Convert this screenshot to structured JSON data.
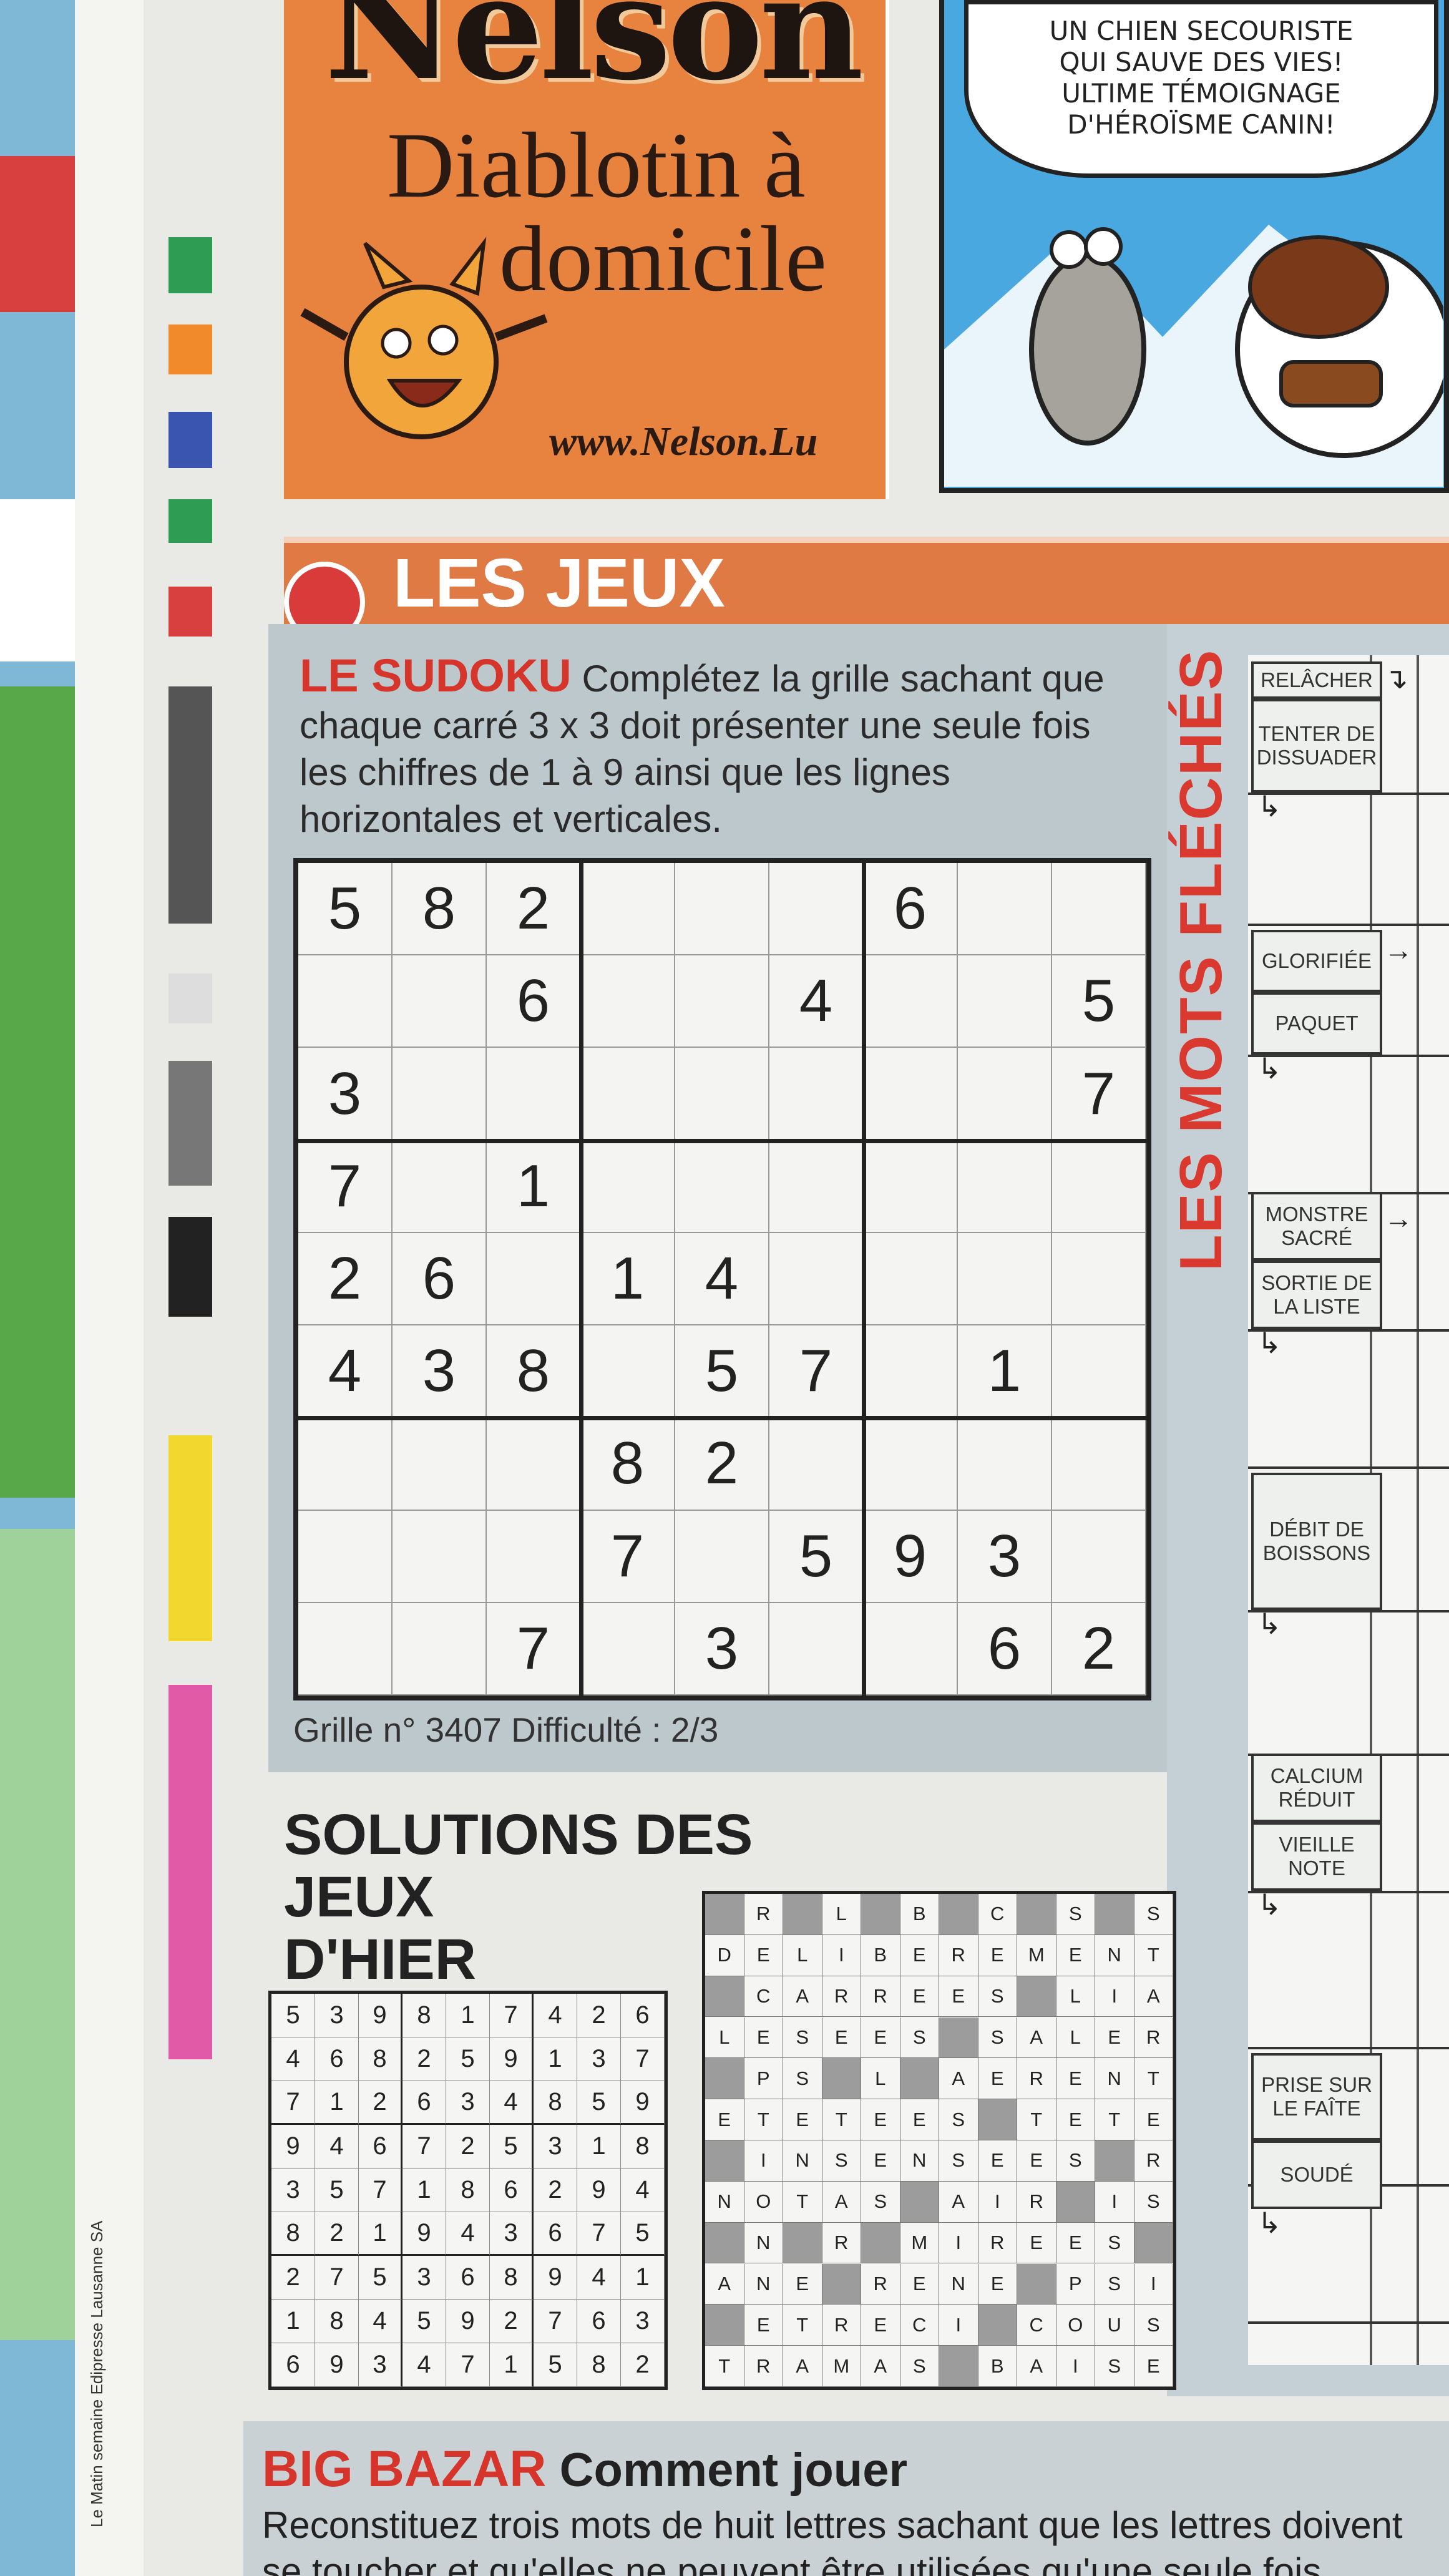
{
  "comic_left": {
    "title": "Nelson",
    "subtitle_line1": "Diablotin à",
    "subtitle_line2": "domicile",
    "url": "www.Nelson.Lu"
  },
  "comic_right": {
    "bubble_lines": [
      "UN CHIEN SECOURISTE",
      "QUI SAUVE DES VIES!",
      "ULTIME TÉMOIGNAGE",
      "D'HÉROÏSME CANIN!"
    ]
  },
  "section_title": "LES JEUX",
  "sudoku": {
    "title": "LE SUDOKU",
    "instructions": "Complétez la grille sachant que chaque carré 3 x 3 doit présenter une seule fois les chiffres de 1 à 9 ainsi que les lignes horizontales et verticales.",
    "grid": [
      [
        "5",
        "8",
        "2",
        "",
        "",
        "",
        "6",
        "",
        ""
      ],
      [
        "",
        "",
        "6",
        "",
        "",
        "4",
        "",
        "",
        "5"
      ],
      [
        "3",
        "",
        "",
        "",
        "",
        "",
        "",
        "",
        "7"
      ],
      [
        "7",
        "",
        "1",
        "",
        "",
        "",
        "",
        "",
        ""
      ],
      [
        "2",
        "6",
        "",
        "1",
        "4",
        "",
        "",
        "",
        ""
      ],
      [
        "4",
        "3",
        "8",
        "",
        "5",
        "7",
        "",
        "1",
        ""
      ],
      [
        "",
        "",
        "",
        "8",
        "2",
        "",
        "",
        "",
        ""
      ],
      [
        "",
        "",
        "",
        "7",
        "",
        "5",
        "9",
        "3",
        ""
      ],
      [
        "",
        "",
        "7",
        "",
        "3",
        "",
        "",
        "6",
        "2"
      ]
    ],
    "grid_info": "Grille n° 3407 Difficulté : 2/3"
  },
  "mots_fleches": {
    "title": "LES MOTS FLÉCHÉS",
    "clues": [
      "RELÂCHER",
      "TENTER DE DISSUADER",
      "GLORIFIÉE",
      "PAQUET",
      "MONSTRE SACRÉ",
      "SORTIE DE LA LISTE",
      "DÉBIT DE BOISSONS",
      "CALCIUM RÉDUIT",
      "VIEILLE NOTE",
      "PRISE SUR LE FAÎTE",
      "SOUDÉ"
    ]
  },
  "solutions": {
    "title_line1": "SOLUTIONS DES JEUX",
    "title_line2": "D'HIER",
    "sudoku": [
      [
        "5",
        "3",
        "9",
        "8",
        "1",
        "7",
        "4",
        "2",
        "6"
      ],
      [
        "4",
        "6",
        "8",
        "2",
        "5",
        "9",
        "1",
        "3",
        "7"
      ],
      [
        "7",
        "1",
        "2",
        "6",
        "3",
        "4",
        "8",
        "5",
        "9"
      ],
      [
        "9",
        "4",
        "6",
        "7",
        "2",
        "5",
        "3",
        "1",
        "8"
      ],
      [
        "3",
        "5",
        "7",
        "1",
        "8",
        "6",
        "2",
        "9",
        "4"
      ],
      [
        "8",
        "2",
        "1",
        "9",
        "4",
        "3",
        "6",
        "7",
        "5"
      ],
      [
        "2",
        "7",
        "5",
        "3",
        "6",
        "8",
        "9",
        "4",
        "1"
      ],
      [
        "1",
        "8",
        "4",
        "5",
        "9",
        "2",
        "7",
        "6",
        "3"
      ],
      [
        "6",
        "9",
        "3",
        "4",
        "7",
        "1",
        "5",
        "8",
        "2"
      ]
    ],
    "crossword": [
      [
        "#",
        "R",
        "#",
        "L",
        "#",
        "B",
        "#",
        "C",
        "#",
        "S",
        "#",
        "S"
      ],
      [
        "D",
        "E",
        "L",
        "I",
        "B",
        "E",
        "R",
        "E",
        "M",
        "E",
        "N",
        "T"
      ],
      [
        "#",
        "C",
        "A",
        "R",
        "R",
        "E",
        "E",
        "S",
        "#",
        "L",
        "I",
        "A"
      ],
      [
        "L",
        "E",
        "S",
        "E",
        "E",
        "S",
        "#",
        "S",
        "A",
        "L",
        "E",
        "R"
      ],
      [
        "#",
        "P",
        "S",
        "#",
        "L",
        "#",
        "A",
        "E",
        "R",
        "E",
        "N",
        "T"
      ],
      [
        "E",
        "T",
        "E",
        "T",
        "E",
        "E",
        "S",
        "#",
        "T",
        "E",
        "T",
        "E"
      ],
      [
        "#",
        "I",
        "N",
        "S",
        "E",
        "N",
        "S",
        "E",
        "E",
        "S",
        "#",
        "R"
      ],
      [
        "N",
        "O",
        "T",
        "A",
        "S",
        "#",
        "A",
        "I",
        "R",
        "#",
        "I",
        "S"
      ],
      [
        "#",
        "N",
        "#",
        "R",
        "#",
        "M",
        "I",
        "R",
        "E",
        "E",
        "S",
        "#"
      ],
      [
        "A",
        "N",
        "E",
        "#",
        "R",
        "E",
        "N",
        "E",
        "#",
        "P",
        "S",
        "I"
      ],
      [
        "#",
        "E",
        "T",
        "R",
        "E",
        "C",
        "I",
        "#",
        "C",
        "O",
        "U",
        "S"
      ],
      [
        "T",
        "R",
        "A",
        "M",
        "A",
        "S",
        "#",
        "B",
        "A",
        "I",
        "S",
        "E"
      ]
    ]
  },
  "big_bazar": {
    "title": "BIG BAZAR",
    "subtitle": "Comment jouer",
    "text": "Reconstituez trois mots de huit lettres sachant que les lettres doivent se toucher et qu'elles ne peuvent être utilisées qu'une seule fois."
  },
  "margin_text": "Le Matin semaine   Edipresse Lausanne SA"
}
